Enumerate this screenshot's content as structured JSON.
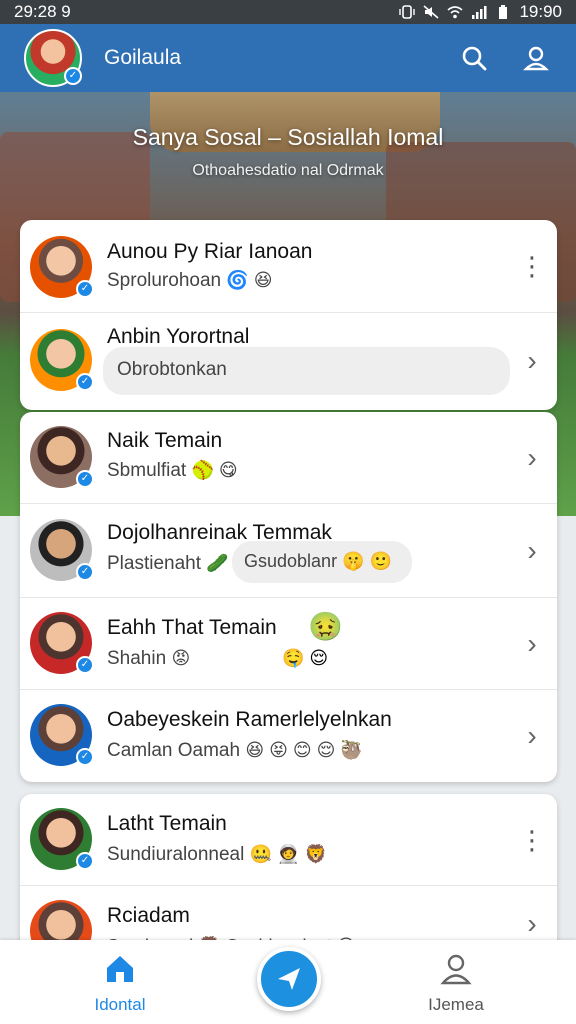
{
  "status_bar": {
    "time_left": "29:28 9",
    "time_right": "19:90"
  },
  "header": {
    "title": "Goilaula"
  },
  "hero": {
    "title": "Sanya Sosal – Sosiallah Iomal",
    "subtitle": "Othoahesdatio nal Odrmak"
  },
  "card1": {
    "items": [
      {
        "name": "Aunou Py Riar Ianoan",
        "subtitle": "Sprolurohoan",
        "emojis": "🌀 😆"
      },
      {
        "name": "Anbin Yorortnal",
        "subtitle": "Obrobtonkan"
      }
    ]
  },
  "card2": {
    "items": [
      {
        "name": "Naik Temain",
        "subtitle": "Sbmulfiat",
        "emojis": "🥎 😋"
      },
      {
        "name": "Dojolhanreinak Temmak",
        "subtitle": "Plastienaht",
        "emojis": "🥒",
        "pill": "Gsudoblanr 🤫 🙂"
      },
      {
        "name": "Eahh That Temain",
        "subtitle": "Shahin",
        "emojis": "😡",
        "extra": "🤢",
        "extra2": "🤤 😌"
      },
      {
        "name": "Oabeyeskein Ramerlelyelnkan",
        "subtitle": "Camlan Oamah",
        "emojis": "😆 😝 😊 😌 🦥"
      }
    ]
  },
  "card3": {
    "items": [
      {
        "name": "Latht Temain",
        "subtitle": "Sundiuralonneal",
        "emojis": "🤐 🧑‍🚀 🦁"
      },
      {
        "name": "Rciadam",
        "subtitle": "Sonduanol 🦁 Oncidanalent 😊"
      }
    ]
  },
  "bottom_nav": {
    "home_label": "Idontal",
    "profile_label": "IJemea"
  },
  "colors": {
    "header": "#2f6fb3",
    "accent": "#1e90e0",
    "verified": "#1e88e5"
  }
}
